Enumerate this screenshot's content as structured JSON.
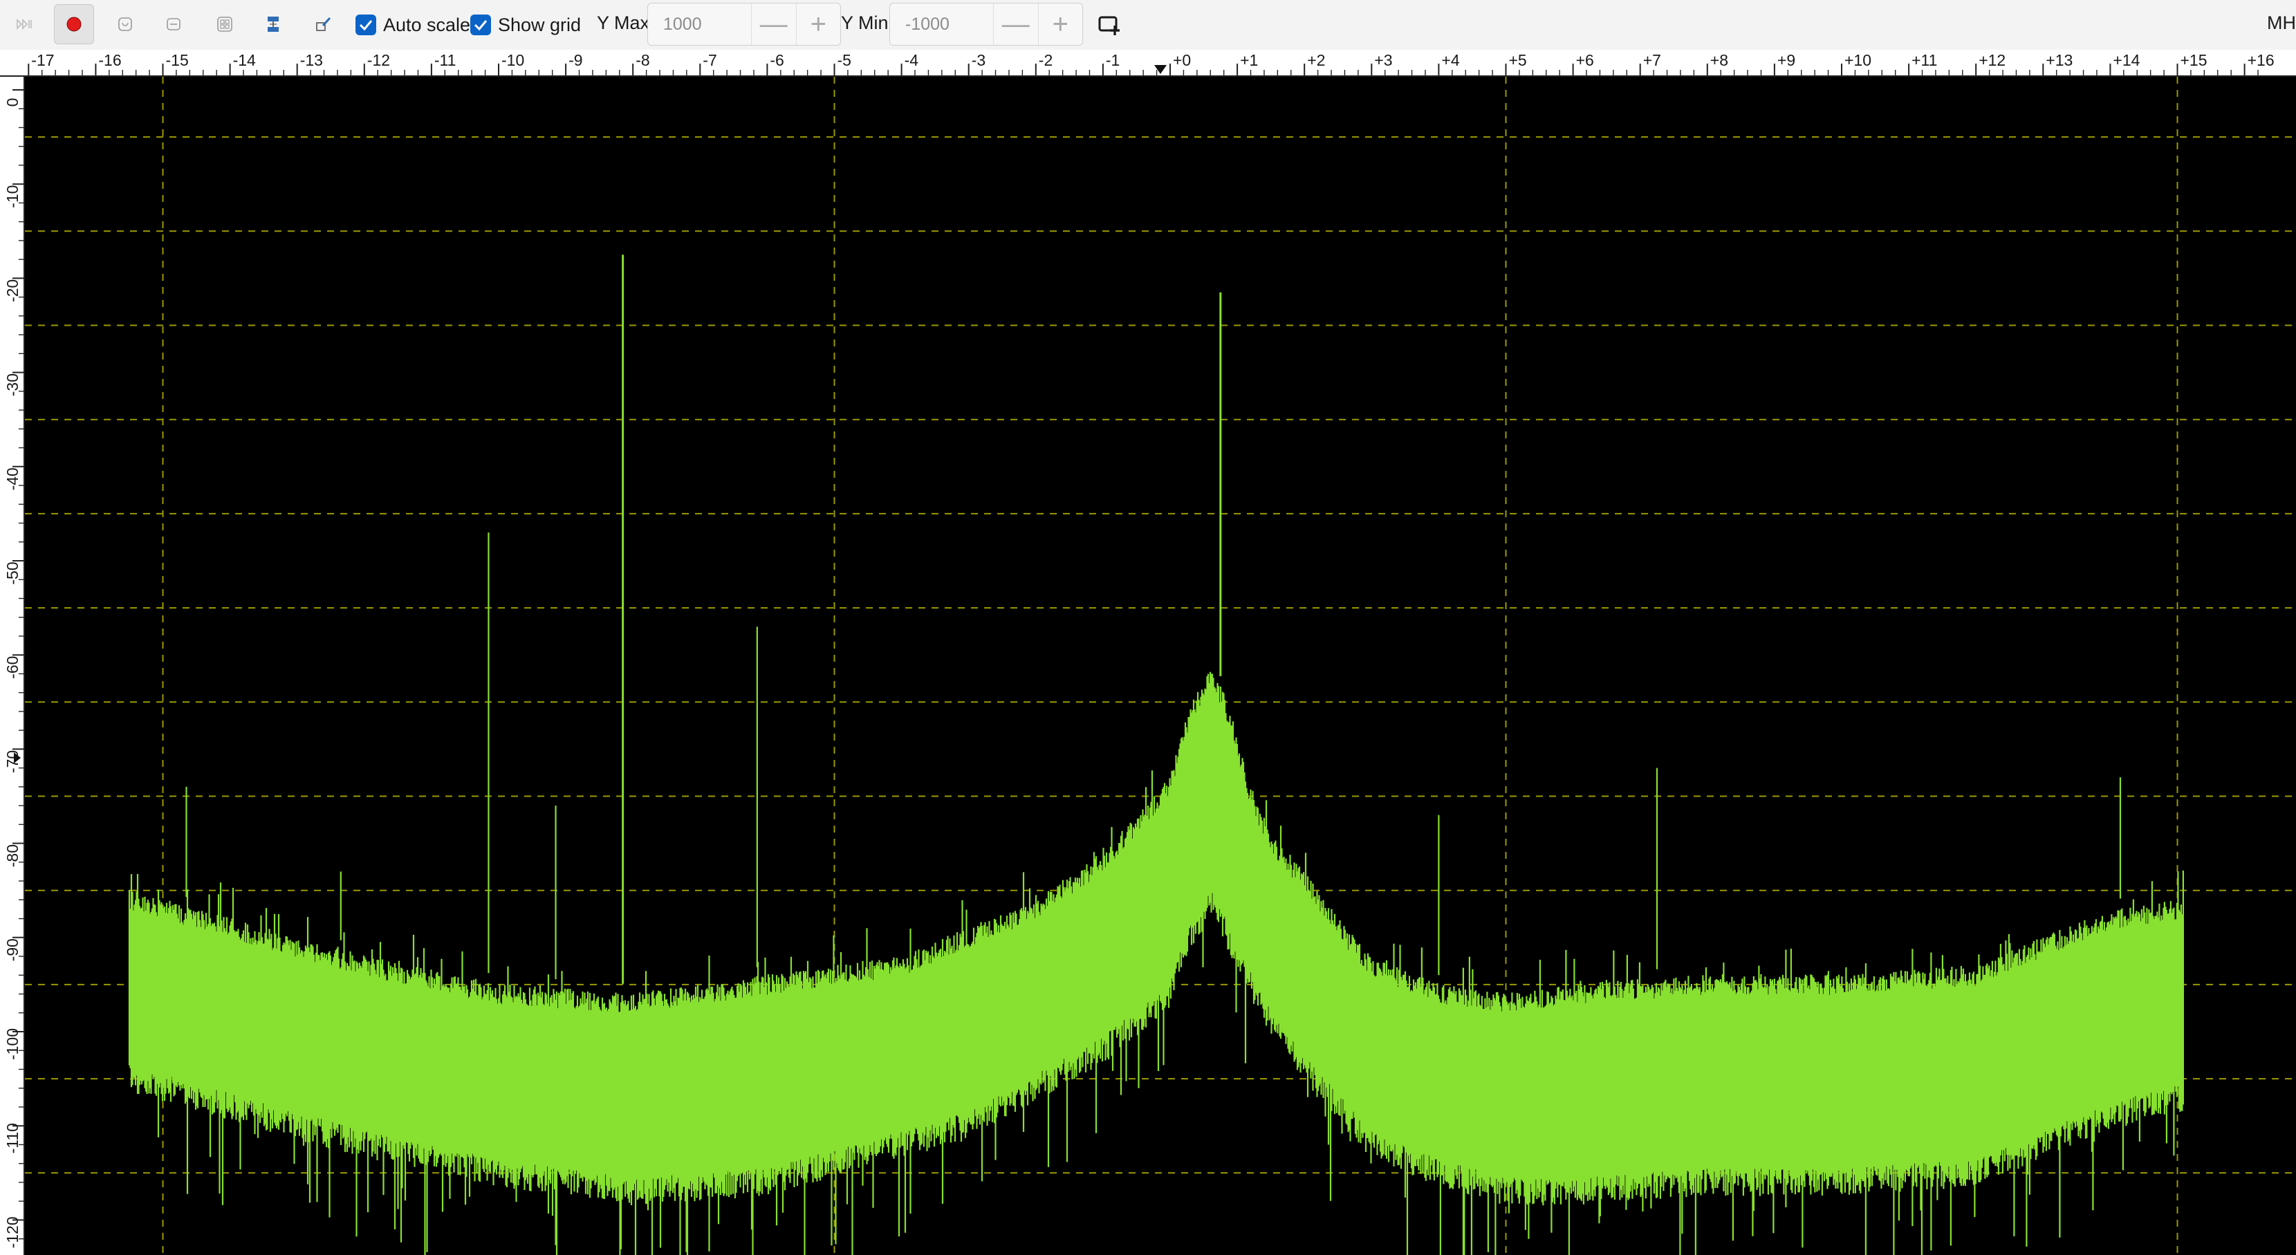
{
  "toolbar": {
    "buttons": [
      "play-pause",
      "record",
      "snapshot",
      "minimize-panel",
      "layout-grid",
      "settings-sliders",
      "edit-window"
    ],
    "auto_scale": {
      "label": "Auto scale",
      "checked": true
    },
    "show_grid": {
      "label": "Show grid",
      "checked": true
    },
    "y_max": {
      "label": "Y Max:",
      "value": "1000",
      "minus": "—",
      "plus": "+"
    },
    "y_min": {
      "label": "Y Min:",
      "value": "-1000",
      "minus": "—",
      "plus": "+"
    },
    "units_partial": "MH",
    "record_color": "#e31b1b",
    "checkbox_color": "#0b63c8"
  },
  "chart_data": {
    "type": "line",
    "title": "",
    "xlabel": "",
    "ylabel": "",
    "x_range": [
      -17,
      16.2
    ],
    "y_range": [
      -125,
      0
    ],
    "x_ticks": [
      "-17",
      "-16",
      "-15",
      "-14",
      "-13",
      "-12",
      "-11",
      "-10",
      "-9",
      "-8",
      "-7",
      "-6",
      "-5",
      "-4",
      "-3",
      "-2",
      "-1",
      "+0",
      "+1",
      "+2",
      "+3",
      "+4",
      "+5",
      "+6",
      "+7",
      "+8",
      "+9",
      "+10",
      "+11",
      "+12",
      "+13",
      "+14",
      "+15",
      "+16"
    ],
    "y_ticks": [
      "0",
      "-10",
      "-20",
      "-30",
      "-40",
      "-50",
      "-60",
      "-70",
      "-80",
      "-90",
      "-100",
      "-110",
      "-120"
    ],
    "grid": true,
    "grid_color": "#9a9a00",
    "trace_color": "#88e030",
    "background": "#000000",
    "series": [
      {
        "spectrum_span": [
          -15.5,
          15.1
        ],
        "x": [
          -15.5,
          -14,
          -12,
          -10,
          -8,
          -6,
          -4,
          -3,
          -2,
          -1,
          -0.5,
          0,
          0.3,
          0.5,
          0.6,
          0.8,
          1.2,
          1.5,
          2,
          2.5,
          3,
          4,
          5,
          6,
          8,
          10,
          12,
          13,
          14,
          15.1
        ],
        "top": [
          -86,
          -89,
          -93,
          -96,
          -97,
          -95,
          -93,
          -90,
          -87,
          -82,
          -78,
          -74,
          -66,
          -64,
          -62,
          -65,
          -75,
          -80,
          -84,
          -89,
          -93,
          -96,
          -97,
          -96,
          -95,
          -95,
          -94,
          -91,
          -88,
          -87
        ],
        "bottom": [
          -105,
          -108,
          -112,
          -115,
          -117,
          -116,
          -112,
          -110,
          -106,
          -102,
          -99,
          -96,
          -90,
          -88,
          -86,
          -89,
          -95,
          -99,
          -104,
          -108,
          -112,
          -115,
          -117,
          -117,
          -116,
          -116,
          -115,
          -112,
          -109,
          -107
        ]
      }
    ],
    "spurs": [
      {
        "x": -8.15,
        "peak": -17.5
      },
      {
        "x": 0.75,
        "peak": -21.5
      },
      {
        "x": -10.15,
        "peak": -47
      },
      {
        "x": -6.15,
        "peak": -57
      },
      {
        "x": -9.15,
        "peak": -76
      },
      {
        "x": -14.65,
        "peak": -74
      },
      {
        "x": -12.35,
        "peak": -83
      },
      {
        "x": 4.0,
        "peak": -77
      },
      {
        "x": 7.25,
        "peak": -72
      },
      {
        "x": 14.15,
        "peak": -73
      }
    ]
  }
}
